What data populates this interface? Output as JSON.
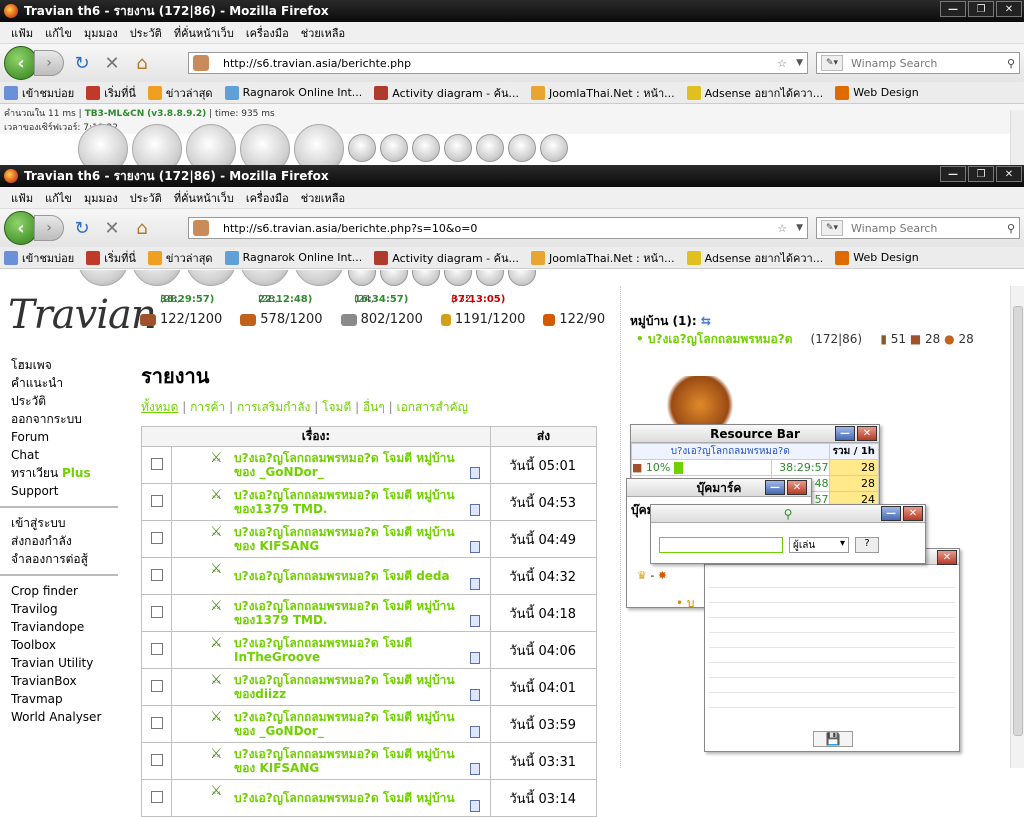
{
  "window_title": "Travian th6 - รายงาน (172|86) - Mozilla Firefox",
  "menu": [
    "แฟ้ม",
    "แก้ไข",
    "มุมมอง",
    "ประวัติ",
    "ที่คั่นหน้าเว็บ",
    "เครื่องมือ",
    "ช่วยเหลือ"
  ],
  "back_window": {
    "url": "http://s6.travian.asia/berichte.php"
  },
  "front_window": {
    "url": "http://s6.travian.asia/berichte.php?s=10&o=0"
  },
  "search_placeholder": "Winamp Search",
  "bookmarks": [
    "เข้าชมบ่อย",
    "เริ่มที่นี่",
    "ข่าวล่าสุด",
    "Ragnarok Online Int...",
    "Activity diagram - ค้น...",
    "JoomlaThai.Net : หน้า...",
    "Adsense อยากได้ควา...",
    "Web Design"
  ],
  "status": {
    "line1_prefix": "คำนวณใน 11 ms |",
    "line1_version": "TB3-ML&CN",
    "line1_ver_num": "(v3.8.8.9.2)",
    "line1_suffix": "time: 935 ms",
    "line2": "เวลาของเซิร์ฟเวอร์: 7:10:32"
  },
  "logo_text": "Travian",
  "left_nav": {
    "group1": [
      "โฮมเพจ",
      "คำแนะนำ",
      "ประวัติ",
      "ออกจากระบบ",
      "Forum",
      "Chat"
    ],
    "plus_prefix": "ทราเวียน",
    "plus_word": "Plus",
    "support": "Support",
    "group2": [
      "เข้าสู่ระบบ",
      "ส่งกองกำลัง",
      "จำลองการต่อสู้"
    ],
    "group3": [
      "Crop finder",
      "Travilog",
      "Traviandope",
      "Toolbox",
      "Travian Utility",
      "TravianBox",
      "Travmap",
      "World Analyser"
    ]
  },
  "resource_timers": [
    {
      "a": "(28,",
      "t": "38:29:57)"
    },
    {
      "a": "(28,",
      "t": "22:12:48)"
    },
    {
      "a": "(24,",
      "t": "16:34:57)"
    },
    {
      "a": "(-32,",
      "t": "37:13:05)"
    }
  ],
  "resources": [
    {
      "name": "wood",
      "value": "122/1200",
      "color": "#a0522d"
    },
    {
      "name": "clay",
      "value": "578/1200",
      "color": "#c2611a"
    },
    {
      "name": "iron",
      "value": "802/1200",
      "color": "#8a8a8a"
    },
    {
      "name": "crop",
      "value": "1191/1200",
      "color": "#d4a017"
    },
    {
      "name": "consumption",
      "value": "122/90",
      "color": "#d45a00"
    }
  ],
  "page_title": "รายงาน",
  "filters": [
    "ทั้งหมด",
    "การค้า",
    "การเสริมกำลัง",
    "โจมตี",
    "อื่นๆ",
    "เอกสารสำคัญ"
  ],
  "table_headers": {
    "subject": "เรื่อง:",
    "sent": "ส่ง"
  },
  "reports": [
    {
      "subject": "บ?งเอ?ญโลกถลมพรหมอ?ด โจมตี หมู่บ้านของ _GoNDor_",
      "date": "วันนี้ 05:01"
    },
    {
      "subject": "บ?งเอ?ญโลกถลมพรหมอ?ด โจมตี หมู่บ้าน ของ1379 TMD.",
      "date": "วันนี้ 04:53"
    },
    {
      "subject": "บ?งเอ?ญโลกถลมพรหมอ?ด โจมตี หมู่บ้านของ KIFSANG",
      "date": "วันนี้ 04:49"
    },
    {
      "subject": "บ?งเอ?ญโลกถลมพรหมอ?ด โจมตี deda",
      "date": "วันนี้ 04:32"
    },
    {
      "subject": "บ?งเอ?ญโลกถลมพรหมอ?ด โจมตี หมู่บ้าน ของ1379 TMD.",
      "date": "วันนี้ 04:18"
    },
    {
      "subject": "บ?งเอ?ญโลกถลมพรหมอ?ด โจมตี InTheGroove",
      "date": "วันนี้ 04:06"
    },
    {
      "subject": "บ?งเอ?ญโลกถลมพรหมอ?ด โจมตี หมู่บ้าน ของdiizz",
      "date": "วันนี้ 04:01"
    },
    {
      "subject": "บ?งเอ?ญโลกถลมพรหมอ?ด โจมตี หมู่บ้านของ _GoNDor_",
      "date": "วันนี้ 03:59"
    },
    {
      "subject": "บ?งเอ?ญโลกถลมพรหมอ?ด โจมตี หมู่บ้านของ KIFSANG",
      "date": "วันนี้ 03:31"
    },
    {
      "subject": "บ?งเอ?ญโลกถลมพรหมอ?ด โจมตี หมู่บ้าน",
      "date": "วันนี้ 03:14"
    }
  ],
  "village": {
    "heading": "หมู่บ้าน (1):",
    "name": "บ?งเอ?ญโลกถลมพรหมอ?ด",
    "coords": "(172|86)",
    "c1": "51",
    "c2": "28",
    "c3": "28"
  },
  "resource_bar": {
    "title": "Resource Bar",
    "village": "บ?งเอ?ญโลกถลมพรหมอ?ด",
    "total_hdr": "รวม / 1h",
    "pct": "10%",
    "time": "38:29:57",
    "rate1": "28",
    "time2": "48",
    "rate2": "28",
    "frag": "57",
    "rate3": "24"
  },
  "bookmark_panel": {
    "title": "บุ๊คมาร์ค",
    "partial": "บุ๊คม"
  },
  "search_panel": {
    "select": "ผู้เล่น",
    "q": "?"
  },
  "bottom_frag": {
    "dash": "-",
    "u": "บ"
  },
  "progress": 0.1
}
